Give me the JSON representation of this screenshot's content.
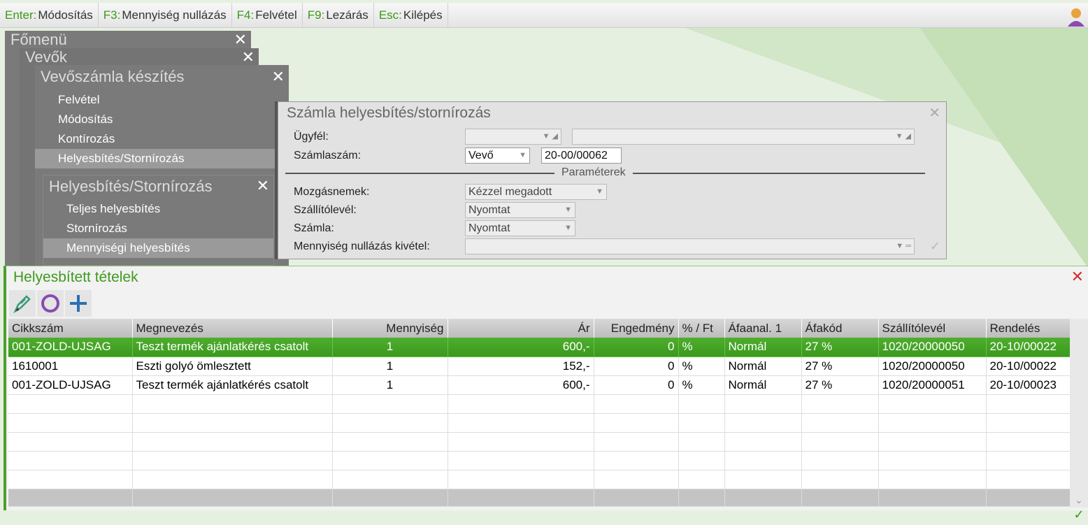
{
  "shortcuts": [
    {
      "key": "Enter:",
      "label": "Módosítás"
    },
    {
      "key": "F3:",
      "label": "Mennyiség nullázás"
    },
    {
      "key": "F4:",
      "label": "Felvétel"
    },
    {
      "key": "F9:",
      "label": "Lezárás"
    },
    {
      "key": "Esc:",
      "label": "Kilépés"
    }
  ],
  "menus": {
    "main": "Főmenü",
    "customers": "Vevők",
    "invoice": {
      "title": "Vevőszámla készítés",
      "items": [
        "Felvétel",
        "Módosítás",
        "Kontírozás",
        "Helyesbítés/Stornírozás"
      ]
    },
    "correction": {
      "title": "Helyesbítés/Stornírozás",
      "items": [
        "Teljes helyesbítés",
        "Stornírozás",
        "Mennyiségi helyesbítés"
      ]
    }
  },
  "dialog": {
    "title": "Számla helyesbítés/stornírozás",
    "client_label": "Ügyfél:",
    "client_code": "",
    "client_name": "",
    "invoice_label": "Számlaszám:",
    "invoice_type": "Vevő",
    "invoice_number": "20-00/00062",
    "section": "Paraméterek",
    "movement_label": "Mozgásnemek:",
    "movement": "Kézzel megadott",
    "delivery_label": "Szállítólevél:",
    "delivery": "Nyomtat",
    "invoice_print_label": "Számla:",
    "invoice_print": "Nyomtat",
    "exception_label": "Mennyiség nullázás kivétel:",
    "exception": ""
  },
  "panel": {
    "title": "Helyesbített tételek",
    "columns": [
      "Cikkszám",
      "Megnevezés",
      "Mennyiség",
      "Ár",
      "Engedmény",
      "% / Ft",
      "Áfaanal. 1",
      "Áfakód",
      "Szállítólevél",
      "Rendelés"
    ],
    "rows": [
      [
        "001-ZOLD-UJSAG",
        "Teszt termék ajánlatkérés csatolt",
        "1",
        "600,-",
        "0",
        "%",
        "Normál",
        "27 %",
        "1020/20000050",
        "20-10/00022"
      ],
      [
        "1610001",
        "Eszti golyó ömlesztett",
        "1",
        "152,-",
        "0",
        "%",
        "Normál",
        "27 %",
        "1020/20000050",
        "20-10/00022"
      ],
      [
        "001-ZOLD-UJSAG",
        "Teszt termék ajánlatkérés csatolt",
        "1",
        "600,-",
        "0",
        "%",
        "Normál",
        "27 %",
        "1020/20000051",
        "20-10/00023"
      ]
    ]
  }
}
